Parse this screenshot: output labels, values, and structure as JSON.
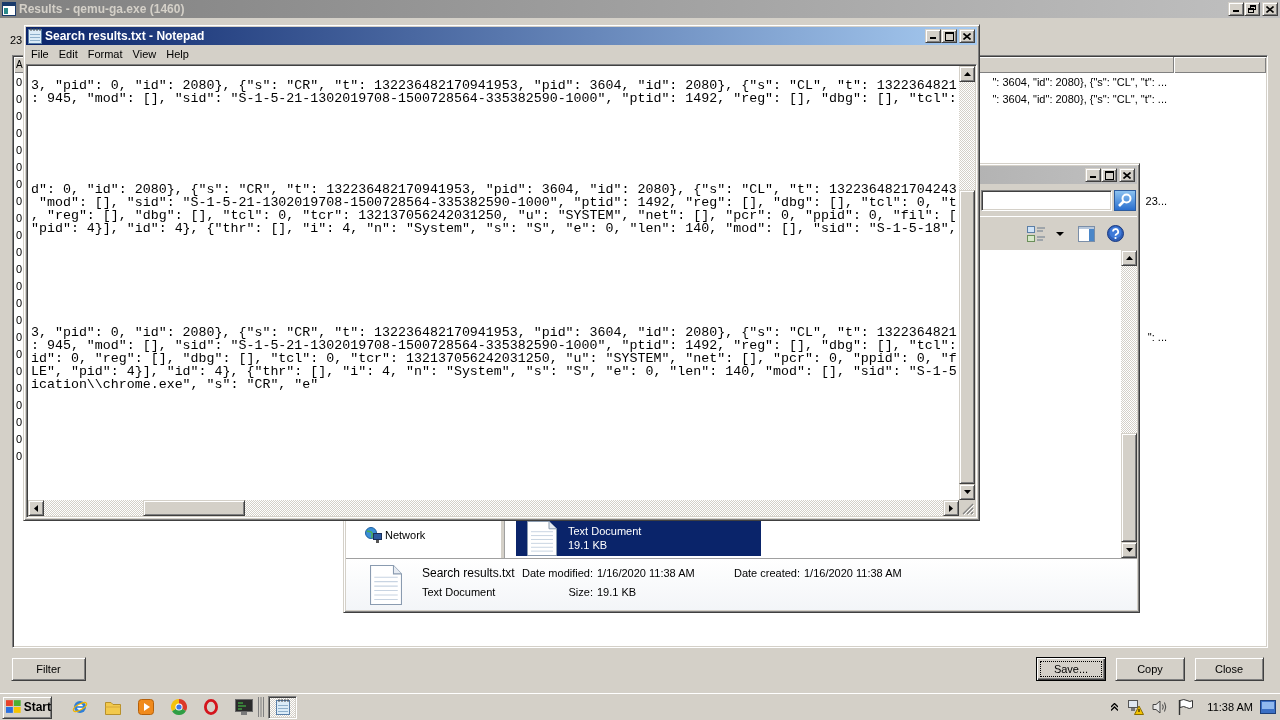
{
  "results_window": {
    "title": "Results - qemu-ga.exe (1460)",
    "active": false,
    "count": "23",
    "list": {
      "columns": [
        "A"
      ],
      "rows": [
        {
          "cells": [
            "0",
            "\": 3604, \"id\": 2080}, {\"s\": \"CL\", \"t\": ..."
          ]
        },
        {
          "cells": [
            "0",
            "\": 3604, \"id\": 2080}, {\"s\": \"CL\", \"t\": ..."
          ]
        },
        {
          "cells": [
            "0"
          ]
        },
        {
          "cells": [
            "0"
          ]
        },
        {
          "cells": [
            "0"
          ]
        },
        {
          "cells": [
            "0"
          ]
        },
        {
          "cells": [
            "0"
          ]
        },
        {
          "cells": [
            "0",
            "23..."
          ]
        },
        {
          "cells": [
            "0"
          ]
        },
        {
          "cells": [
            "0"
          ]
        },
        {
          "cells": [
            "0"
          ]
        },
        {
          "cells": [
            "0"
          ]
        },
        {
          "cells": [
            "0"
          ]
        },
        {
          "cells": [
            "0"
          ]
        },
        {
          "cells": [
            "0"
          ]
        },
        {
          "cells": [
            "0",
            "\": ..."
          ]
        },
        {
          "cells": [
            "0"
          ]
        },
        {
          "cells": [
            "0"
          ]
        },
        {
          "cells": [
            "0"
          ]
        },
        {
          "cells": [
            "0"
          ]
        },
        {
          "cells": [
            "0"
          ]
        },
        {
          "cells": [
            "0"
          ]
        },
        {
          "cells": [
            "0"
          ]
        }
      ]
    },
    "left_buttons": [
      {
        "label": "Filter",
        "focused": false
      }
    ],
    "right_buttons": [
      {
        "label": "Save...",
        "focused": true
      },
      {
        "label": "Copy",
        "focused": false
      },
      {
        "label": "Close",
        "focused": false
      }
    ]
  },
  "explorer_window": {
    "active": false,
    "nav_pane": {
      "items": [
        {
          "kind": "network",
          "label": "Network"
        }
      ]
    },
    "file_list": {
      "items": [
        {
          "type": "Text Document",
          "size": "19.1 KB",
          "selected": true
        }
      ]
    },
    "details_pane": {
      "name": "Search results.txt",
      "type": "Text Document",
      "fields": [
        {
          "label": "Date modified:",
          "value": "1/16/2020 11:38 AM"
        },
        {
          "label": "Date created:",
          "value": "1/16/2020 11:38 AM"
        },
        {
          "label": "Size:",
          "value": "19.1 KB"
        }
      ]
    }
  },
  "notepad": {
    "title": "Search results.txt - Notepad",
    "active": true,
    "menu": [
      "File",
      "Edit",
      "Format",
      "View",
      "Help"
    ],
    "text_blocks": [
      {
        "lines": [
          "3, \"pid\": 0, \"id\": 2080}, {\"s\": \"CR\", \"t\": 132236482170941953, \"pid\": 3604, \"id\": 2080}, {\"s\": \"CL\", \"t\": 1322364821",
          ": 945, \"mod\": [], \"sid\": \"S-1-5-21-1302019708-1500728564-335382590-1000\", \"ptid\": 1492, \"reg\": [], \"dbg\": [], \"tcl\":"
        ]
      },
      {
        "lines": [
          "d\": 0, \"id\": 2080}, {\"s\": \"CR\", \"t\": 132236482170941953, \"pid\": 3604, \"id\": 2080}, {\"s\": \"CL\", \"t\": 1322364821704243",
          " \"mod\": [], \"sid\": \"S-1-5-21-1302019708-1500728564-335382590-1000\", \"ptid\": 1492, \"reg\": [], \"dbg\": [], \"tcl\": 0, \"t",
          ", \"reg\": [], \"dbg\": [], \"tcl\": 0, \"tcr\": 132137056242031250, \"u\": \"SYSTEM\", \"net\": [], \"pcr\": 0, \"ppid\": 0, \"fil\": [",
          "\"pid\": 4}], \"id\": 4}, {\"thr\": [], \"i\": 4, \"n\": \"System\", \"s\": \"S\", \"e\": 0, \"len\": 140, \"mod\": [], \"sid\": \"S-1-5-18\","
        ]
      },
      {
        "lines": [
          "3, \"pid\": 0, \"id\": 2080}, {\"s\": \"CR\", \"t\": 132236482170941953, \"pid\": 3604, \"id\": 2080}, {\"s\": \"CL\", \"t\": 1322364821",
          ": 945, \"mod\": [], \"sid\": \"S-1-5-21-1302019708-1500728564-335382590-1000\", \"ptid\": 1492, \"reg\": [], \"dbg\": [], \"tcl\":",
          "id\": 0, \"reg\": [], \"dbg\": [], \"tcl\": 0, \"tcr\": 132137056242031250, \"u\": \"SYSTEM\", \"net\": [], \"pcr\": 0, \"ppid\": 0, \"f",
          "LE\", \"pid\": 4}], \"id\": 4}, {\"thr\": [], \"i\": 4, \"n\": \"System\", \"s\": \"S\", \"e\": 0, \"len\": 140, \"mod\": [], \"sid\": \"S-1-5",
          "ication\\\\chrome.exe\", \"s\": \"CR\", \"e\""
        ]
      }
    ]
  },
  "taskbar": {
    "start_label": "Start",
    "tasks": [
      {
        "selected": true
      }
    ],
    "clock": "11:38 AM"
  }
}
